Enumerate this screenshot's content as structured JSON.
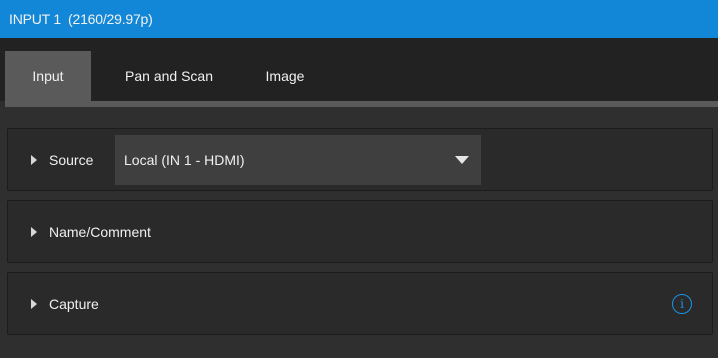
{
  "window": {
    "title": "INPUT 1",
    "format": "(2160/29.97p)"
  },
  "tabs": [
    {
      "label": "Input",
      "active": true
    },
    {
      "label": "Pan and Scan",
      "active": false
    },
    {
      "label": "Image",
      "active": false
    }
  ],
  "panels": {
    "source": {
      "label": "Source",
      "dropdown_value": "Local (IN 1 - HDMI)",
      "icon": "caret-right-icon"
    },
    "name_comment": {
      "label": "Name/Comment",
      "icon": "caret-right-icon"
    },
    "capture": {
      "label": "Capture",
      "icon": "caret-right-icon",
      "info_icon": "info-icon",
      "info_glyph": "i"
    }
  },
  "colors": {
    "titlebar": "#1287d7",
    "accent": "#1a93e6",
    "active_tab": "#5a5a5a",
    "background": "#2d2d2d"
  }
}
